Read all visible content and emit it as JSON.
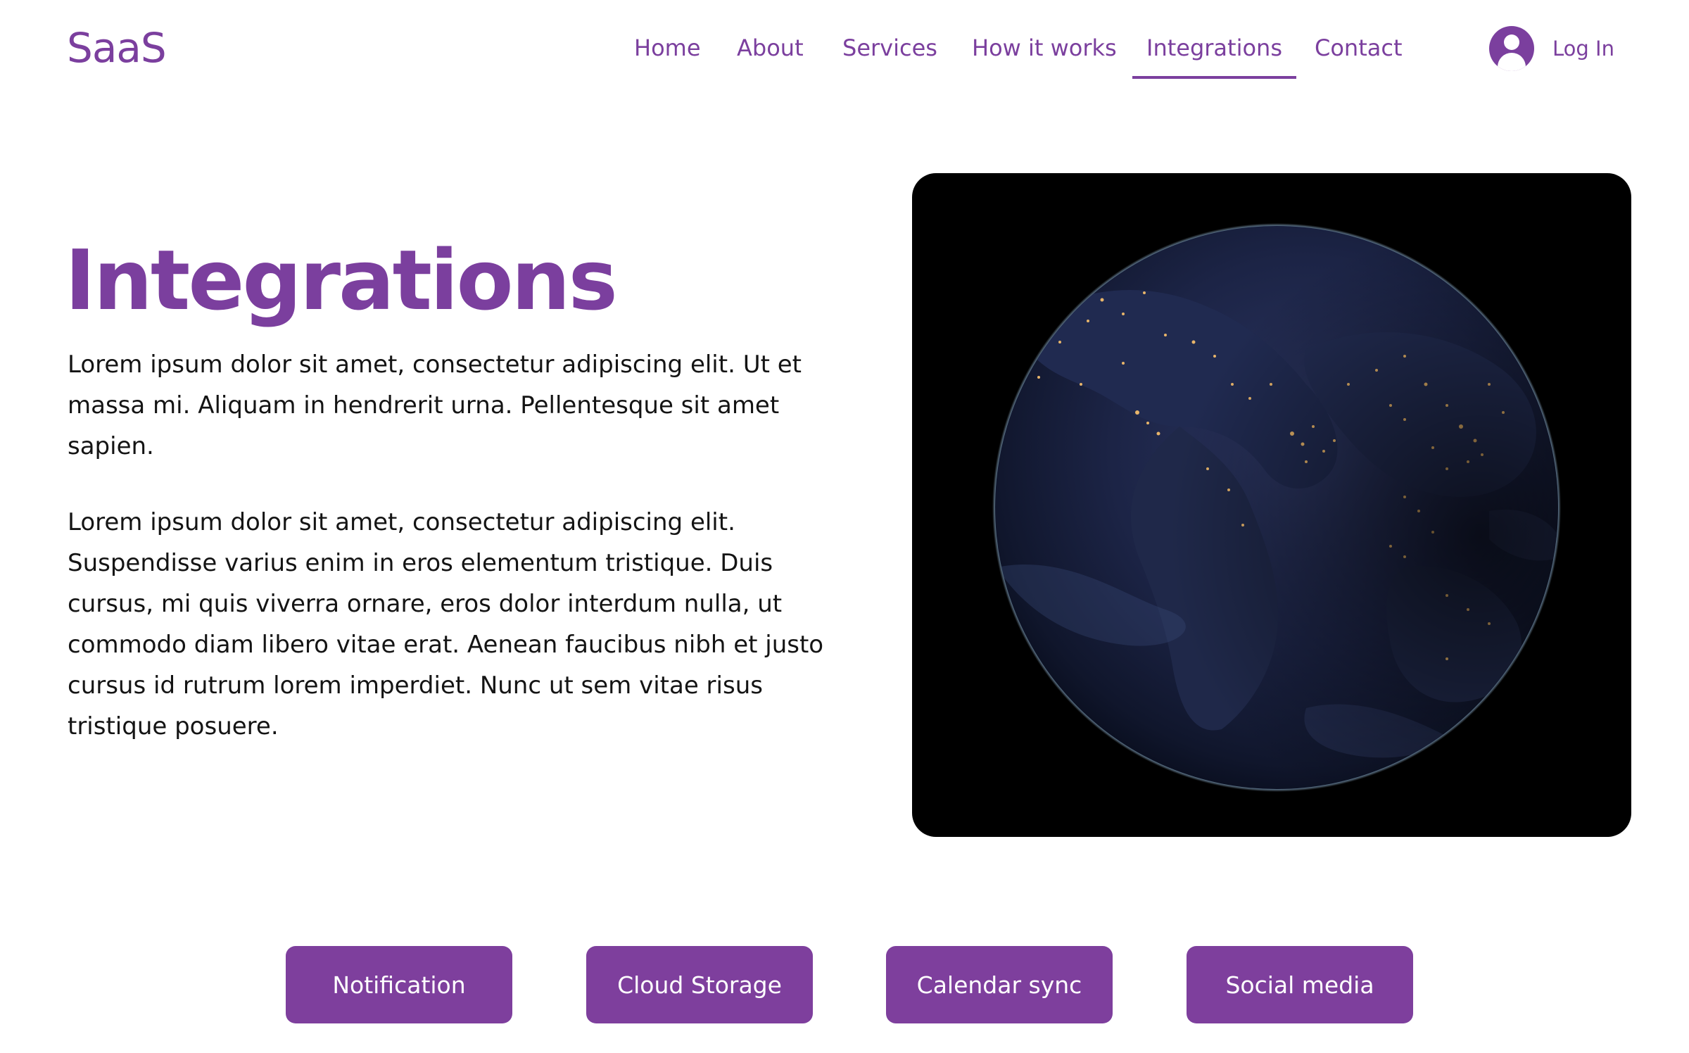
{
  "header": {
    "logo": "SaaS",
    "nav": [
      {
        "label": "Home",
        "active": false
      },
      {
        "label": "About",
        "active": false
      },
      {
        "label": "Services",
        "active": false
      },
      {
        "label": "How it works",
        "active": false
      },
      {
        "label": "Integrations",
        "active": true
      },
      {
        "label": "Contact",
        "active": false
      }
    ],
    "login_label": "Log In",
    "login_icon": "user-avatar-icon"
  },
  "hero": {
    "title": "Integrations",
    "paragraphs": [
      "Lorem ipsum dolor sit amet, consectetur adipiscing elit. Ut et massa mi. Aliquam in hendrerit urna. Pellentesque sit amet sapien.",
      "Lorem ipsum dolor sit amet, consectetur adipiscing elit. Suspendisse varius enim in eros elementum tristique. Duis cursus, mi quis viverra ornare, eros dolor interdum nulla, ut commodo diam libero vitae erat. Aenean faucibus nibh et justo cursus id rutrum lorem imperdiet. Nunc ut sem vitae risus tristique posuere."
    ]
  },
  "integrations": [
    {
      "label": "Notification"
    },
    {
      "label": "Cloud Storage"
    },
    {
      "label": "Calendar sync"
    },
    {
      "label": "Social media"
    }
  ],
  "colors": {
    "brand": "#7b3f9e",
    "button_bg": "#7e3f9d",
    "button_text": "#ffffff",
    "image_bg": "#000000"
  }
}
